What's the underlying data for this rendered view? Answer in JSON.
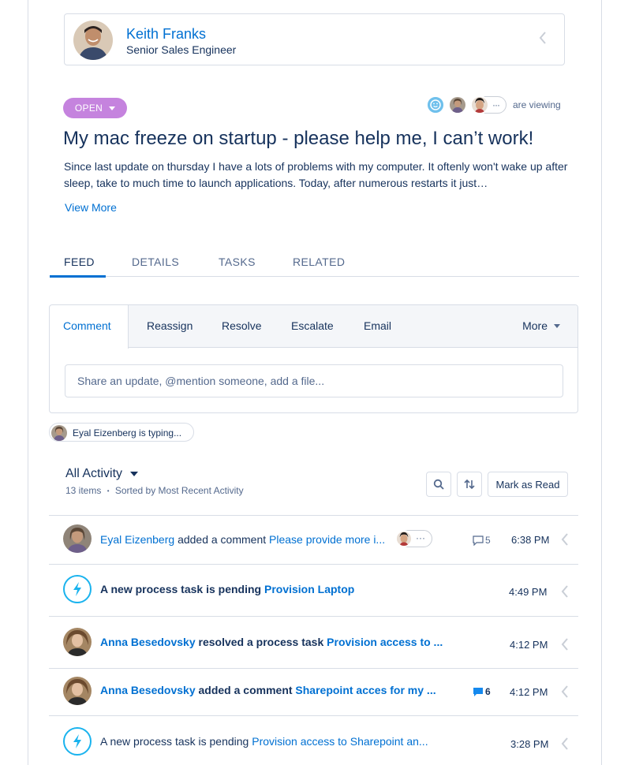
{
  "contact": {
    "name": "Keith Franks",
    "role": "Senior Sales Engineer",
    "avatar_icon": "person-avatar"
  },
  "case": {
    "status": "OPEN",
    "status_color": "#c583de",
    "viewing_text": "are viewing",
    "viewers_more": "···",
    "title": "My mac freeze on startup - please help me, I can’t work!",
    "description": "Since last update on thursday I have a lots of problems with my computer. It oftenly won't wake up after sleep, take to much time to launch applications. Today, after numerous restarts it just…",
    "view_more": "View More"
  },
  "tabs": [
    {
      "label": "FEED",
      "active": true
    },
    {
      "label": "DETAILS",
      "active": false
    },
    {
      "label": "TASKS",
      "active": false
    },
    {
      "label": "RELATED",
      "active": false
    }
  ],
  "publisher": {
    "tabs": [
      "Comment",
      "Reassign",
      "Resolve",
      "Escalate",
      "Email"
    ],
    "more": "More",
    "placeholder": "Share an update, @mention someone, add a file..."
  },
  "typing": "Eyal Eizenberg is typing...",
  "activity": {
    "title": "All Activity",
    "count": "13 items",
    "separator": "•",
    "sort": "Sorted by Most Recent Activity",
    "mark_read": "Mark as Read"
  },
  "feed": [
    {
      "actor": "Eyal Eizenberg",
      "action": "added a comment",
      "target": "Please provide more i...",
      "comments": "5",
      "time": "6:38 PM",
      "unread": false,
      "icon": "person-avatar"
    },
    {
      "actor": "",
      "action": "A new process task is pending",
      "target": "Provision Laptop",
      "comments": "",
      "time": "4:49 PM",
      "unread": true,
      "icon": "lightning-icon"
    },
    {
      "actor": "Anna Besedovsky",
      "action": "resolved a process task",
      "target": "Provision access to ...",
      "comments": "",
      "time": "4:12 PM",
      "unread": true,
      "icon": "person-avatar"
    },
    {
      "actor": "Anna Besedovsky",
      "action": "added a comment",
      "target": "Sharepoint acces for my ...",
      "comments": "6",
      "time": "4:12 PM",
      "unread": true,
      "icon": "person-avatar"
    },
    {
      "actor": "",
      "action": "A new process task is pending",
      "target": "Provision access to Sharepoint an...",
      "comments": "",
      "time": "3:28 PM",
      "unread": false,
      "icon": "lightning-icon"
    }
  ],
  "colors": {
    "link": "#0070d2",
    "text": "#16325c",
    "muted": "#54698d",
    "border": "#d8dde6",
    "bolt": "#1ab3ee"
  }
}
